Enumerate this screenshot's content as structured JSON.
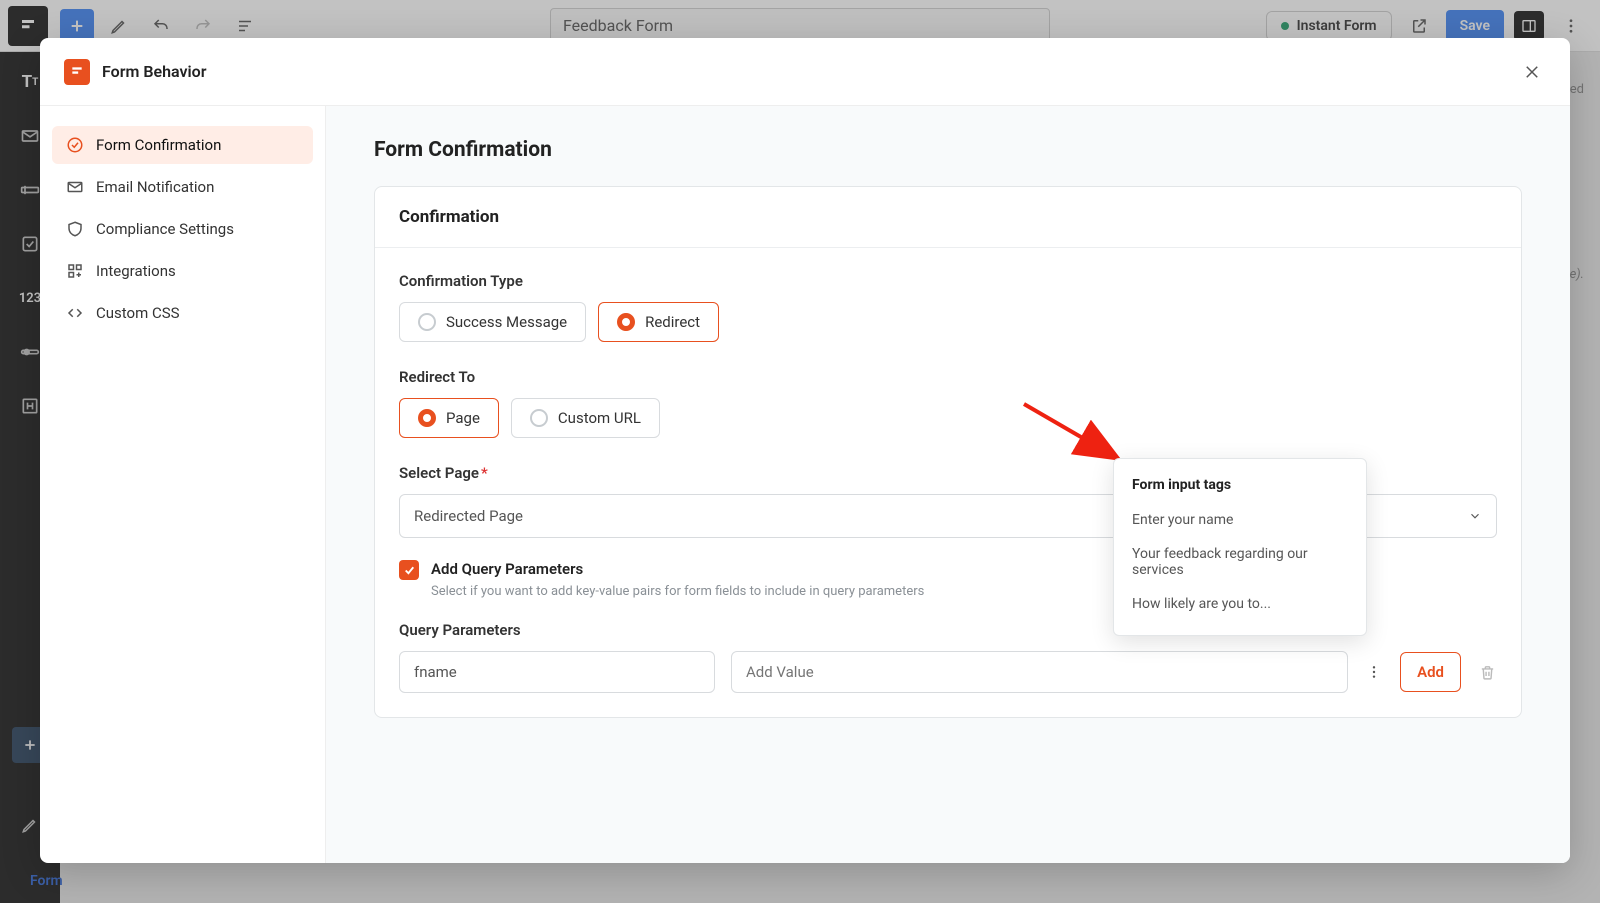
{
  "topbar": {
    "form_title": "Feedback Form",
    "instant_form": "Instant Form",
    "save": "Save"
  },
  "left_rail": {
    "label_123": "123"
  },
  "bottom_crumb": "Form",
  "right_hint": {
    "text1": "ced",
    "text2": "le)."
  },
  "modal": {
    "title": "Form Behavior",
    "sidebar": {
      "items": [
        {
          "label": "Form Confirmation"
        },
        {
          "label": "Email Notification"
        },
        {
          "label": "Compliance Settings"
        },
        {
          "label": "Integrations"
        },
        {
          "label": "Custom CSS"
        }
      ]
    },
    "content": {
      "section_title": "Form Confirmation",
      "card_title": "Confirmation",
      "confirmation_type_label": "Confirmation Type",
      "confirmation_types": {
        "success": "Success Message",
        "redirect": "Redirect"
      },
      "redirect_to_label": "Redirect To",
      "redirect_targets": {
        "page": "Page",
        "custom_url": "Custom URL"
      },
      "select_page_label": "Select Page",
      "select_page_value": "Redirected Page",
      "add_query_label": "Add Query Parameters",
      "add_query_hint": "Select if you want to add key-value pairs for form fields to include in query parameters",
      "query_params_label": "Query Parameters",
      "param_key_value": "fname",
      "param_value_placeholder": "Add Value",
      "add_button": "Add"
    }
  },
  "popover": {
    "title": "Form input tags",
    "items": [
      "Enter your name",
      "Your feedback regarding our services",
      "How likely are you to..."
    ]
  }
}
